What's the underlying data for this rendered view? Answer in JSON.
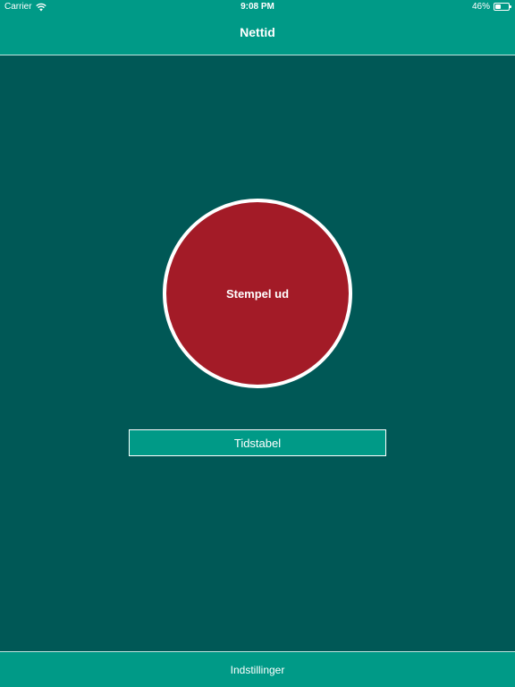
{
  "status_bar": {
    "carrier": "Carrier",
    "time": "9:08 PM",
    "battery_percent": "46%",
    "battery_level": 0.46,
    "wifi_icon": "wifi-icon",
    "battery_icon": "battery-icon"
  },
  "nav": {
    "title": "Nettid"
  },
  "main": {
    "stamp_button_label": "Stempel ud",
    "timetable_button_label": "Tidstabel"
  },
  "bottom": {
    "settings_label": "Indstillinger"
  },
  "colors": {
    "teal_bar": "#009a87",
    "background": "#005856",
    "stamp_red": "#a31b27"
  }
}
